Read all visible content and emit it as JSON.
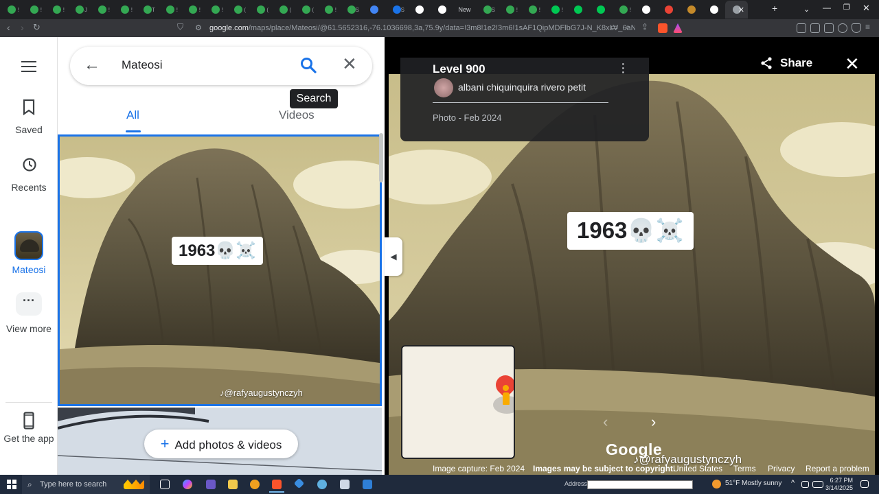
{
  "browser": {
    "tabs": [
      {
        "color": "#34a853",
        "text": "!"
      },
      {
        "color": "#34a853",
        "text": "!"
      },
      {
        "color": "#34a853",
        "text": "!"
      },
      {
        "color": "#34a853",
        "text": "J"
      },
      {
        "color": "#34a853",
        "text": "!"
      },
      {
        "color": "#34a853",
        "text": "!"
      },
      {
        "color": "#34a853",
        "text": "T"
      },
      {
        "color": "#34a853",
        "text": "!"
      },
      {
        "color": "#34a853",
        "text": "!"
      },
      {
        "color": "#34a853",
        "text": "!"
      },
      {
        "color": "#34a853",
        "text": "("
      },
      {
        "color": "#34a853",
        "text": "("
      },
      {
        "color": "#34a853",
        "text": "("
      },
      {
        "color": "#34a853",
        "text": "("
      },
      {
        "color": "#34a853",
        "text": "!"
      },
      {
        "color": "#34a853",
        "text": "S"
      },
      {
        "color": "#4285f4",
        "text": ""
      },
      {
        "color": "#1a73e8",
        "text": "S"
      },
      {
        "color": "#ffffff",
        "text": ""
      },
      {
        "color": "#ffffff",
        "text": ""
      },
      {
        "color": "",
        "text": "New"
      },
      {
        "color": "#34a853",
        "text": "S"
      },
      {
        "color": "#34a853",
        "text": "!"
      },
      {
        "color": "#34a853",
        "text": "!"
      },
      {
        "color": "#00c853",
        "text": "!"
      },
      {
        "color": "#00c853",
        "text": ""
      },
      {
        "color": "#00c853",
        "text": ""
      },
      {
        "color": "#34a853",
        "text": "!"
      },
      {
        "color": "#ffffff",
        "text": ""
      },
      {
        "color": "#ea4335",
        "text": ""
      },
      {
        "color": "#c58a2a",
        "text": ""
      },
      {
        "color": "#ffffff",
        "text": ""
      },
      {
        "color": "#9aa0a6",
        "text": ""
      }
    ],
    "active_tab_close": "✕",
    "new_tab": "+",
    "url_host": "google.com",
    "url_path": "/maps/place/Mateosi/@61.5652316,-76.1036698,3a,75.9y/data=!3m8!1e2!3m6!1sAF1QipMDFlbG7J-N_K8xLV_6aNuQSyE_wXd..."
  },
  "rail": {
    "saved": "Saved",
    "recents": "Recents",
    "place": "Mateosi",
    "more": "View more",
    "app": "Get the app"
  },
  "search": {
    "query": "Mateosi",
    "tooltip": "Search"
  },
  "tabs": {
    "all": "All",
    "videos": "Videos"
  },
  "photo": {
    "overlay_text": "1963💀☠️",
    "credit": "@rafyaugustynczyh",
    "credit_viewer": "@rafyaugustynczyh"
  },
  "add_button": "Add photos & videos",
  "viewer": {
    "title": "Level 900",
    "author": "albani chiquinquira rivero petit",
    "date": "Photo - Feb 2024",
    "share": "Share",
    "logo": "Google"
  },
  "footer": {
    "capture": "Image capture: Feb 2024",
    "copyright": "Images may be subject to copyright.",
    "country": "United States",
    "terms": "Terms",
    "privacy": "Privacy",
    "report": "Report a problem"
  },
  "taskbar": {
    "search_placeholder": "Type here to search",
    "address_label": "Address",
    "weather": "51°F  Mostly sunny",
    "time": "6:27 PM",
    "date": "3/14/2025"
  },
  "colors": {
    "accent": "#1a73e8",
    "sepia_sky": "#d8cfa0",
    "rock": "#6b6048"
  }
}
